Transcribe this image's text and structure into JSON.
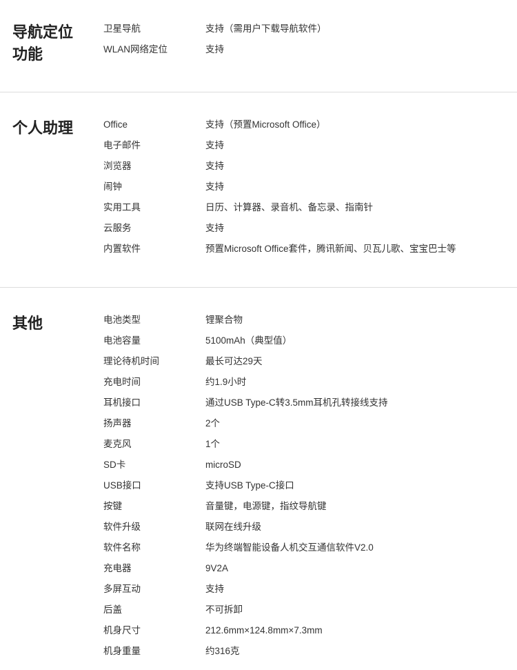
{
  "sections": [
    {
      "title": "导航定位\n功能",
      "rows": [
        {
          "key": "卫星导航",
          "value": "支持（需用户下载导航软件）"
        },
        {
          "key": "WLAN网络定位",
          "value": "支持"
        }
      ]
    },
    {
      "title": "个人助理",
      "rows": [
        {
          "key": "Office",
          "value": "支持（预置Microsoft Office）"
        },
        {
          "key": "电子邮件",
          "value": "支持"
        },
        {
          "key": "浏览器",
          "value": "支持"
        },
        {
          "key": "闹钟",
          "value": "支持"
        },
        {
          "key": "实用工具",
          "value": "日历、计算器、录音机、备忘录、指南针"
        },
        {
          "key": "云服务",
          "value": "支持"
        },
        {
          "key": "内置软件",
          "value": "预置Microsoft Office套件，腾讯新闻、贝瓦儿歌、宝宝巴士等"
        }
      ]
    },
    {
      "title": "其他",
      "rows": [
        {
          "key": "电池类型",
          "value": "锂聚合物"
        },
        {
          "key": "电池容量",
          "value": "5100mAh（典型值）"
        },
        {
          "key": "理论待机时间",
          "value": "最长可达29天"
        },
        {
          "key": "充电时间",
          "value": "约1.9小时"
        },
        {
          "key": "耳机接口",
          "value": "通过USB Type-C转3.5mm耳机孔转接线支持"
        },
        {
          "key": "扬声器",
          "value": "2个"
        },
        {
          "key": "麦克风",
          "value": "1个"
        },
        {
          "key": "SD卡",
          "value": "microSD"
        },
        {
          "key": "USB接口",
          "value": "支持USB Type-C接口"
        },
        {
          "key": "按键",
          "value": "音量键，电源键，指纹导航键"
        },
        {
          "key": "软件升级",
          "value": "联网在线升级"
        },
        {
          "key": "软件名称",
          "value": "华为终端智能设备人机交互通信软件V2.0"
        },
        {
          "key": "充电器",
          "value": "9V2A"
        },
        {
          "key": "多屏互动",
          "value": "支持"
        },
        {
          "key": "后盖",
          "value": "不可拆卸"
        },
        {
          "key": "机身尺寸",
          "value": "212.6mm×124.8mm×7.3mm"
        },
        {
          "key": "机身重量",
          "value": "约316克"
        }
      ]
    }
  ]
}
